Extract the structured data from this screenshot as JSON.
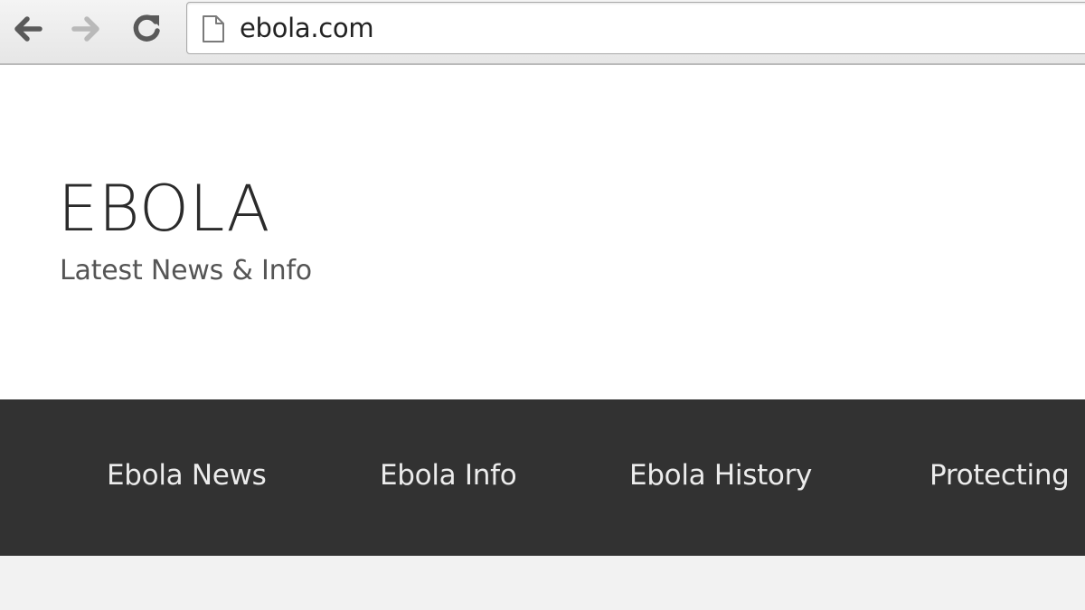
{
  "browser": {
    "url": "ebola.com",
    "icons": {
      "back": "arrow-left-icon",
      "forward": "arrow-right-icon",
      "reload": "reload-icon",
      "page": "page-icon"
    }
  },
  "site": {
    "title": "EBOLA",
    "tagline": "Latest News & Info"
  },
  "menu": {
    "items": [
      {
        "label": "Ebola News"
      },
      {
        "label": "Ebola Info"
      },
      {
        "label": "Ebola History"
      },
      {
        "label": "Protecting"
      }
    ]
  },
  "colors": {
    "menu_background": "#323232",
    "menu_text": "#ececec",
    "title_text": "#2b2b2b",
    "content_background": "#f2f2f2"
  }
}
